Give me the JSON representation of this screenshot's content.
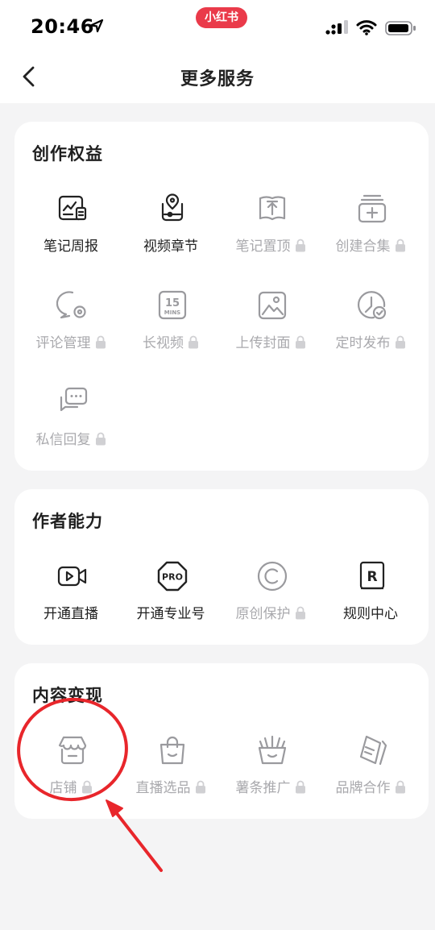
{
  "status_bar": {
    "time": "20:46",
    "app_badge": "小红书"
  },
  "nav": {
    "title": "更多服务"
  },
  "colors": {
    "accent": "#ea3a4a",
    "locked_text": "#a9a9ad",
    "annotation": "#e8262b"
  },
  "sections": [
    {
      "title": "创作权益",
      "items": [
        {
          "label": "笔记周报",
          "icon": "note-report-icon",
          "locked": false
        },
        {
          "label": "视频章节",
          "icon": "video-chapter-icon",
          "locked": false
        },
        {
          "label": "笔记置顶",
          "icon": "pin-note-icon",
          "locked": true
        },
        {
          "label": "创建合集",
          "icon": "collection-add-icon",
          "locked": true
        },
        {
          "label": "评论管理",
          "icon": "comment-manage-icon",
          "locked": true
        },
        {
          "label": "长视频",
          "icon": "long-video-icon",
          "locked": true
        },
        {
          "label": "上传封面",
          "icon": "upload-cover-icon",
          "locked": true
        },
        {
          "label": "定时发布",
          "icon": "scheduled-publish-icon",
          "locked": true
        },
        {
          "label": "私信回复",
          "icon": "message-reply-icon",
          "locked": true
        }
      ]
    },
    {
      "title": "作者能力",
      "items": [
        {
          "label": "开通直播",
          "icon": "live-camera-icon",
          "locked": false
        },
        {
          "label": "开通专业号",
          "icon": "pro-badge-icon",
          "locked": false
        },
        {
          "label": "原创保护",
          "icon": "copyright-icon",
          "locked": true
        },
        {
          "label": "规则中心",
          "icon": "rules-book-icon",
          "locked": false
        }
      ]
    },
    {
      "title": "内容变现",
      "items": [
        {
          "label": "店铺",
          "icon": "shop-icon",
          "locked": true
        },
        {
          "label": "直播选品",
          "icon": "shopping-bag-icon",
          "locked": true
        },
        {
          "label": "薯条推广",
          "icon": "fries-promo-icon",
          "locked": true
        },
        {
          "label": "品牌合作",
          "icon": "brand-cooperation-icon",
          "locked": true
        }
      ]
    }
  ]
}
